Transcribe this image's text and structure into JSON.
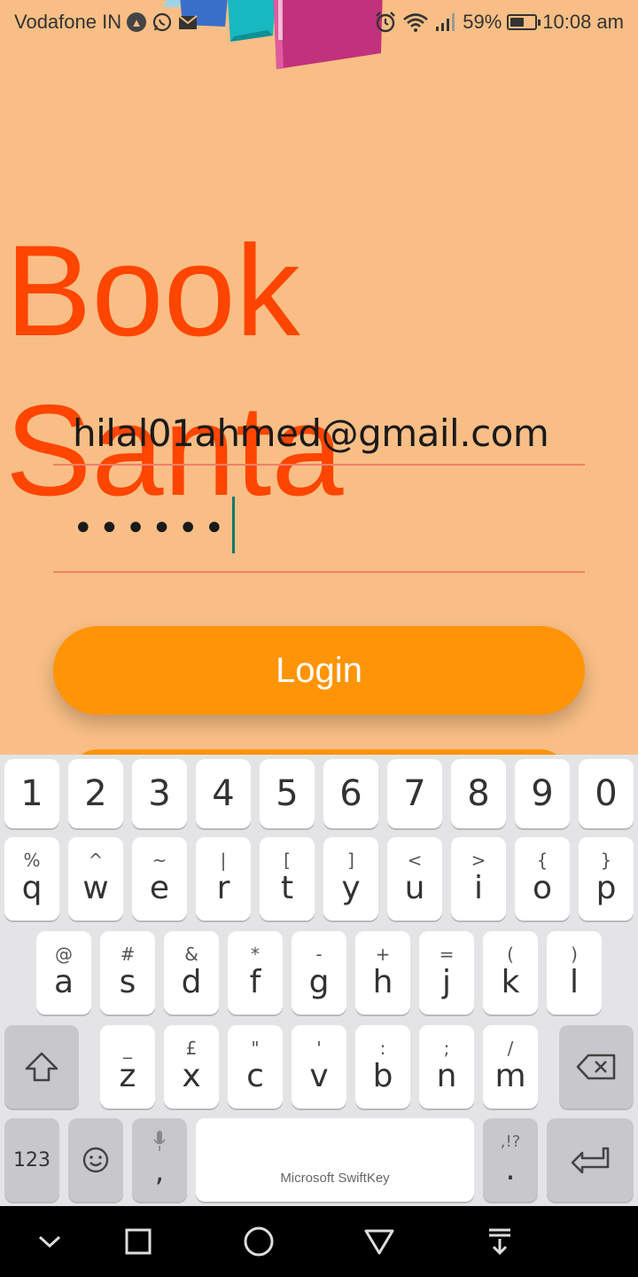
{
  "status_bar": {
    "carrier": "Vodafone IN",
    "battery_percent": "59%",
    "battery_level": 0.59,
    "time": "10:08 am",
    "left_icons": [
      "nav-arrow-icon",
      "whatsapp-icon",
      "mail-icon"
    ],
    "right_icons": [
      "alarm-icon",
      "wifi-icon",
      "signal-icon",
      "battery-icon"
    ]
  },
  "app": {
    "title": "Book Santa"
  },
  "login_form": {
    "email_value": "hilal01ahmed@gmail.com",
    "password_value": "••••••",
    "login_label": "Login"
  },
  "keyboard": {
    "number_row": [
      "1",
      "2",
      "3",
      "4",
      "5",
      "6",
      "7",
      "8",
      "9",
      "0"
    ],
    "row1": [
      {
        "hint": "%",
        "main": "q"
      },
      {
        "hint": "^",
        "main": "w"
      },
      {
        "hint": "~",
        "main": "e"
      },
      {
        "hint": "|",
        "main": "r"
      },
      {
        "hint": "[",
        "main": "t"
      },
      {
        "hint": "]",
        "main": "y"
      },
      {
        "hint": "<",
        "main": "u"
      },
      {
        "hint": ">",
        "main": "i"
      },
      {
        "hint": "{",
        "main": "o"
      },
      {
        "hint": "}",
        "main": "p"
      }
    ],
    "row2": [
      {
        "hint": "@",
        "main": "a"
      },
      {
        "hint": "#",
        "main": "s"
      },
      {
        "hint": "&",
        "main": "d"
      },
      {
        "hint": "*",
        "main": "f"
      },
      {
        "hint": "-",
        "main": "g"
      },
      {
        "hint": "+",
        "main": "h"
      },
      {
        "hint": "=",
        "main": "j"
      },
      {
        "hint": "(",
        "main": "k"
      },
      {
        "hint": ")",
        "main": "l"
      }
    ],
    "row3": [
      {
        "hint": "_",
        "main": "z"
      },
      {
        "hint": "£",
        "main": "x"
      },
      {
        "hint": "\"",
        "main": "c"
      },
      {
        "hint": "'",
        "main": "v"
      },
      {
        "hint": ":",
        "main": "b"
      },
      {
        "hint": ";",
        "main": "n"
      },
      {
        "hint": "/",
        "main": "m"
      }
    ],
    "symbols_label": "123",
    "comma_label": ",",
    "space_label": "Microsoft SwiftKey",
    "punct_hint": ",!?",
    "period_label": "."
  },
  "colors": {
    "background": "#f8be85",
    "title": "#ff4500",
    "button": "#ff9407",
    "underline": "#f0806a"
  }
}
